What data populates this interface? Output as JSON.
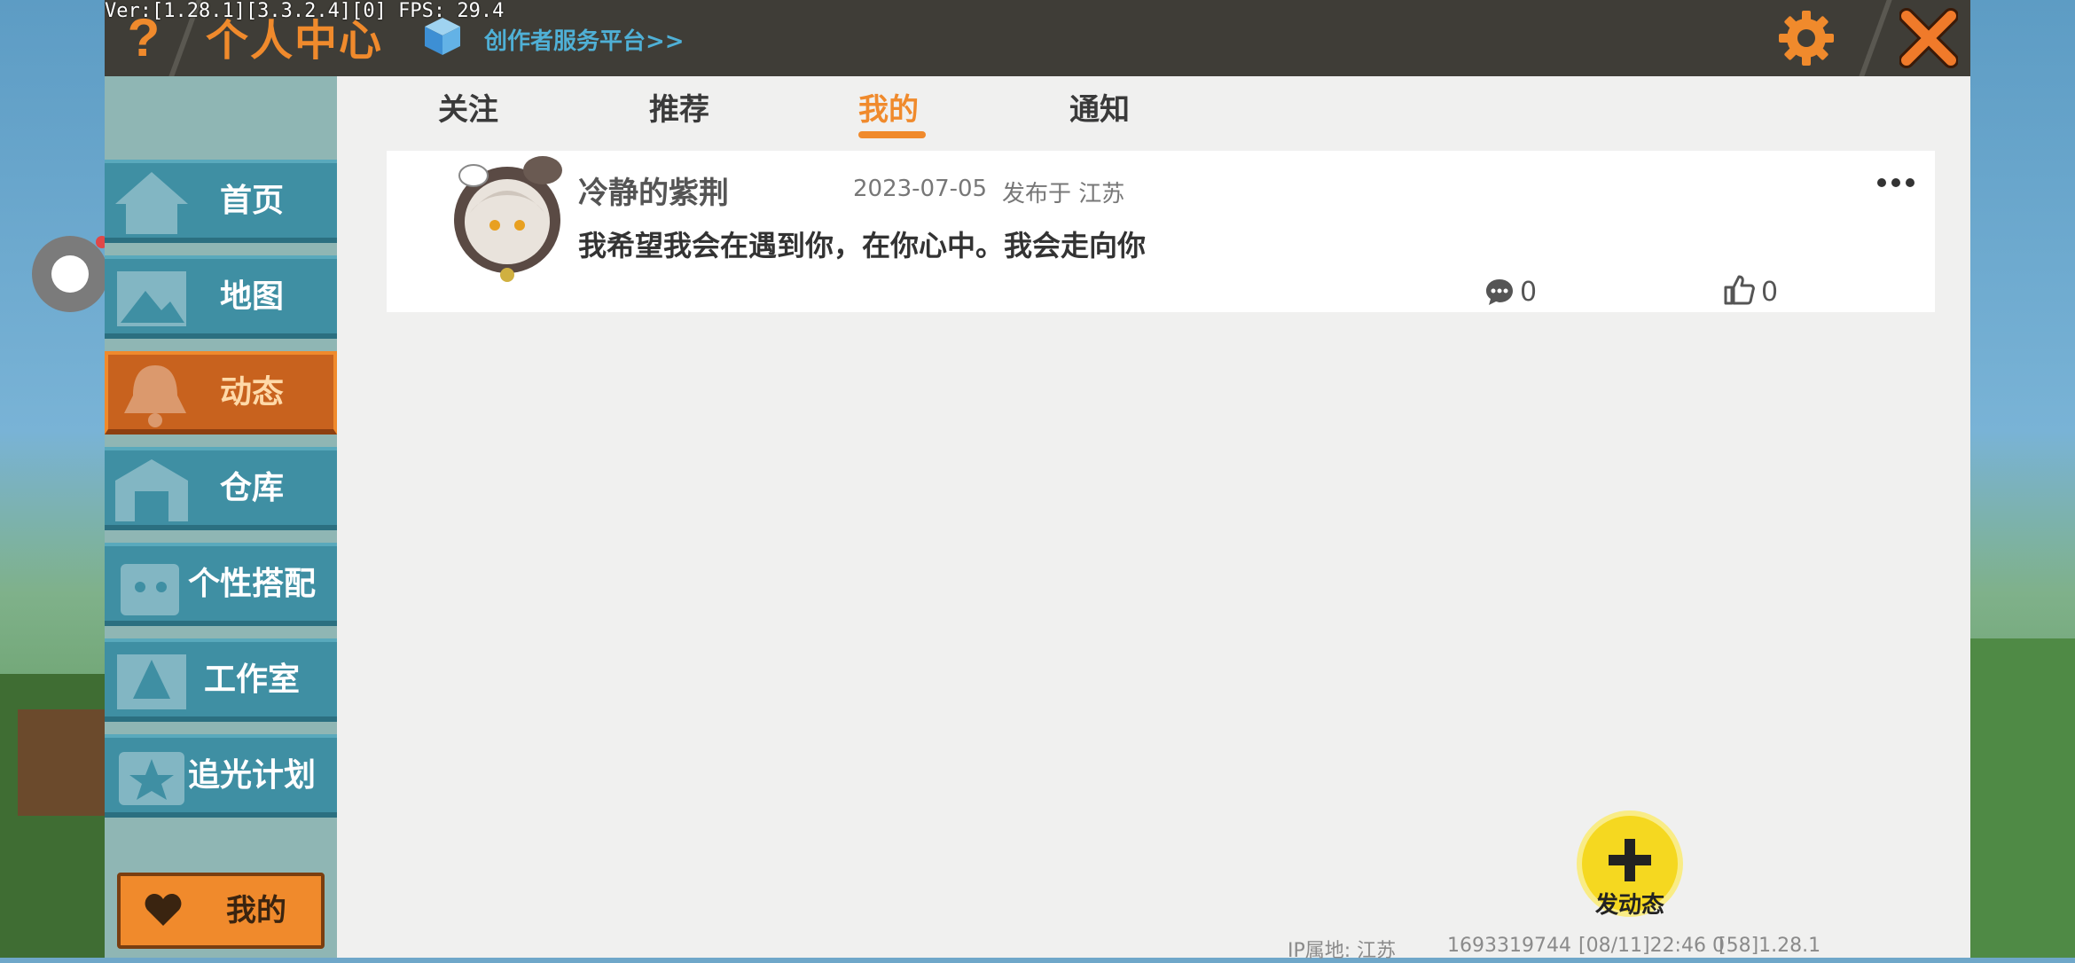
{
  "debug": "Ver:[1.28.1][3.3.2.4][0] FPS: 29.4",
  "header": {
    "title": "个人中心",
    "creator_link": "创作者服务平台>>"
  },
  "tabs": [
    {
      "label": "关注"
    },
    {
      "label": "推荐"
    },
    {
      "label": "我的"
    },
    {
      "label": "通知"
    }
  ],
  "active_tab": "我的",
  "sidebar": {
    "items": [
      {
        "label": "首页"
      },
      {
        "label": "地图"
      },
      {
        "label": "动态"
      },
      {
        "label": "仓库"
      },
      {
        "label": "个性搭配"
      },
      {
        "label": "工作室"
      },
      {
        "label": "追光计划"
      }
    ],
    "active": "动态",
    "my_button": "我的"
  },
  "post": {
    "author": "冷静的紫荆",
    "date": "2023-07-05",
    "location": "发布于 江苏",
    "text": "我希望我会在遇到你，在你心中。我会走向你",
    "comments": "0",
    "likes": "0"
  },
  "fab": {
    "label": "发动态"
  },
  "footer": {
    "ip": "IP属地: 江苏",
    "uid": "1693319744",
    "time": "[08/11]22:46 0",
    "version": "[58]1.28.1"
  },
  "colors": {
    "accent": "#f08a2c",
    "sidebar": "#3f8fa3",
    "topbar": "#3f3d37",
    "link": "#4fb0d6"
  }
}
